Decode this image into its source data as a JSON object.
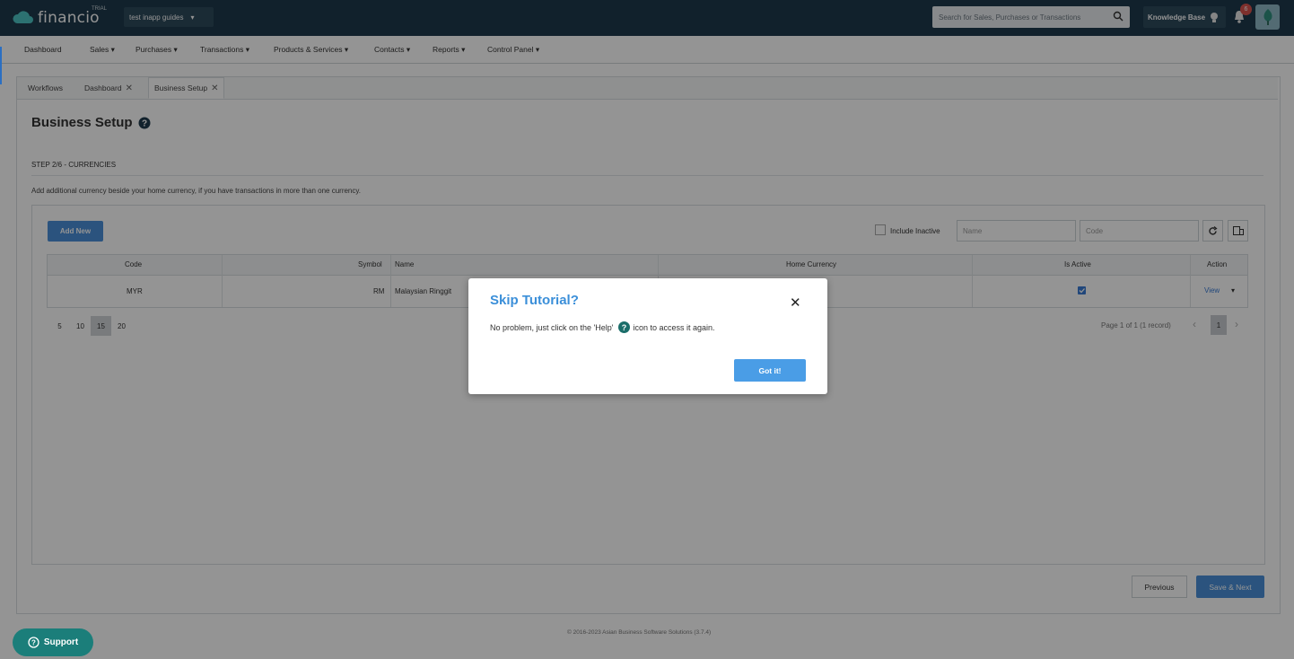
{
  "app": {
    "logo_text": "financio",
    "badge": "TRIAL",
    "company": "test inapp guides",
    "search_placeholder": "Search for Sales, Purchases or Transactions",
    "knowledge_base": "Knowledge Base",
    "notification_count": "6"
  },
  "nav": {
    "items": [
      "Dashboard",
      "Sales ▾",
      "Purchases ▾",
      "Transactions ▾",
      "Products & Services ▾",
      "Contacts ▾",
      "Reports ▾",
      "Control Panel ▾"
    ]
  },
  "tabs": {
    "workflows": "Workflows",
    "dashboard": "Dashboard",
    "business_setup": "Business Setup"
  },
  "page": {
    "title": "Business Setup",
    "step": "STEP 2/6 - CURRENCIES",
    "description": "Add additional currency beside your home currency, if you have transactions in more than one currency.",
    "add_new": "Add New",
    "include_inactive": "Include Inactive",
    "name_placeholder": "Name",
    "code_placeholder": "Code"
  },
  "table": {
    "headers": {
      "code": "Code",
      "symbol": "Symbol",
      "name": "Name",
      "home_currency": "Home Currency",
      "is_active": "Is Active",
      "action": "Action"
    },
    "rows": [
      {
        "code": "MYR",
        "symbol": "RM",
        "name": "Malaysian Ringgit",
        "home_currency": "",
        "is_active": true,
        "action": "View"
      }
    ]
  },
  "pagination": {
    "sizes": [
      "5",
      "10",
      "15",
      "20"
    ],
    "selected_size": "15",
    "info": "Page 1 of 1 (1 record)",
    "current_page": "1"
  },
  "buttons": {
    "previous": "Previous",
    "save_next": "Save & Next"
  },
  "footer": "© 2016-2023 Asian Business Software Solutions (3.7.4)",
  "support": "Support",
  "modal": {
    "title": "Skip Tutorial?",
    "text_before": "No problem, just click on the 'Help'",
    "text_after": "icon to access it again.",
    "button": "Got it!"
  },
  "colors": {
    "topbar": "#1e3a4c",
    "primary": "#4a90d9",
    "modal_title": "#3b8fd9",
    "support": "#1b7e7a"
  }
}
